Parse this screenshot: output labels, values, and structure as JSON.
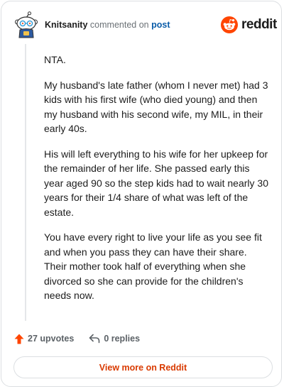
{
  "header": {
    "author": "Knitsanity",
    "commented_text": "commented on",
    "post_link": "post",
    "brand": "reddit"
  },
  "colors": {
    "brand_orange": "#FF4500",
    "link_blue": "#0a5ca8",
    "cta_orange": "#d93a00",
    "text_dark": "#1c1c1c",
    "text_muted": "#6b7176"
  },
  "comment": {
    "paragraphs": [
      "NTA.",
      "My husband's late father (whom I never met) had 3 kids with his first wife (who died young) and then my husband with his second wife, my MIL, in their early 40s.",
      "His will left everything to his wife for her upkeep for the remainder of her life. She passed early this year aged 90 so the step kids had to wait nearly 30 years for their 1/4 share of what was left of the estate.",
      "You have every right to live your life as you see fit and when you pass they can have their share. Their mother took half of everything when she divorced so she can provide for the children's needs now."
    ]
  },
  "actions": {
    "upvotes_label": "27 upvotes",
    "replies_label": "0 replies",
    "upvote_icon": "upvote-arrow-icon",
    "reply_icon": "reply-arrow-icon"
  },
  "footer": {
    "view_more_label": "View more on Reddit"
  }
}
